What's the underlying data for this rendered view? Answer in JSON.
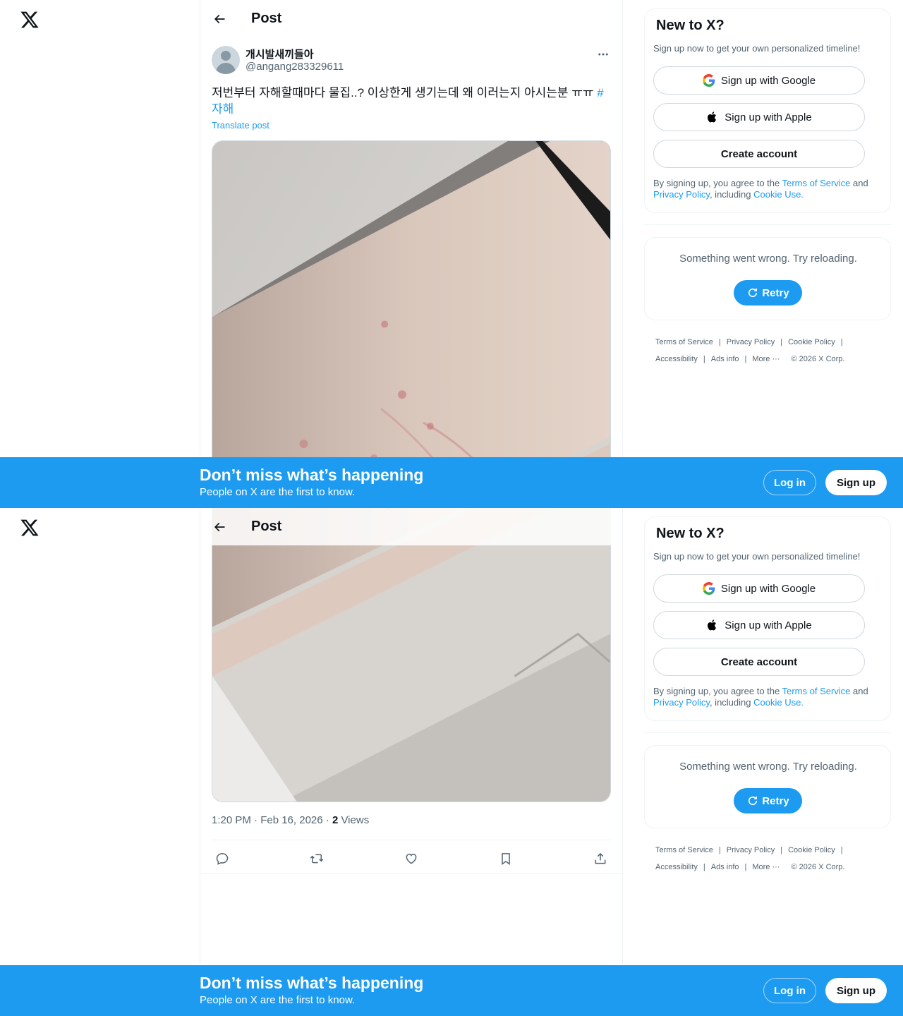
{
  "header": {
    "title": "Post"
  },
  "post": {
    "display_name": "개시발새끼들아",
    "handle": "@angang283329611",
    "text": "저번부터 자해할때마다 물집..? 이상한게 생기는데 왜 이러는지 아시는분 ㅠㅠ",
    "hashtag": "#자해",
    "translate": "Translate post",
    "time": "1:20 PM · Feb 16, 2026 · ",
    "views_count": "2",
    "views_label": " Views"
  },
  "signup_card": {
    "title": "New to X?",
    "subtitle": "Sign up now to get your own personalized timeline!",
    "google": "Sign up with Google",
    "apple": "Sign up with Apple",
    "create": "Create account",
    "legal_prefix": "By signing up, you agree to the ",
    "terms": "Terms of Service",
    "and": " and ",
    "privacy": "Privacy Policy",
    "including": ", including ",
    "cookie": "Cookie Use."
  },
  "error_card": {
    "message": "Something went wrong. Try reloading.",
    "retry": "Retry"
  },
  "footer": {
    "terms": "Terms of Service",
    "privacy": "Privacy Policy",
    "cookie": "Cookie Policy",
    "accessibility": "Accessibility",
    "ads": "Ads info",
    "more": "More ···",
    "copyright": "© 2026 X Corp."
  },
  "banner": {
    "title": "Don’t miss what’s happening",
    "subtitle": "People on X are the first to know.",
    "login": "Log in",
    "signup": "Sign up"
  },
  "colors": {
    "accent": "#1d9bf0",
    "text": "#0f1419",
    "muted": "#536471",
    "border": "#eff3f4"
  }
}
